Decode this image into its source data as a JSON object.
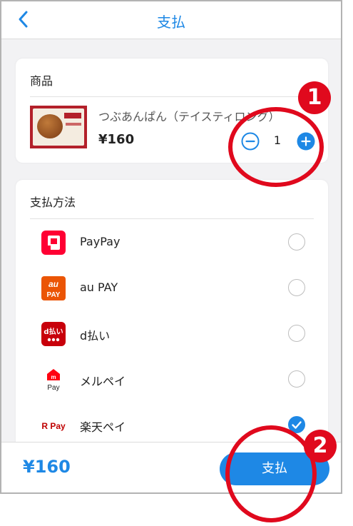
{
  "header": {
    "title": "支払"
  },
  "product_section": {
    "label": "商品",
    "item": {
      "name": "つぶあんぱん（テイスティロング）",
      "price": "¥160",
      "quantity": "1"
    }
  },
  "payment_section": {
    "label": "支払方法",
    "methods": [
      {
        "name": "PayPay",
        "icon": "paypay-icon",
        "selected": false
      },
      {
        "name": "au PAY",
        "icon": "aupay-icon",
        "icon_text_top": "au",
        "icon_text_bottom": "PAY",
        "selected": false
      },
      {
        "name": "d払い",
        "icon": "dbarai-icon",
        "icon_text": "d払い",
        "selected": false
      },
      {
        "name": "メルペイ",
        "icon": "merpay-icon",
        "icon_text": "Pay",
        "selected": false
      },
      {
        "name": "楽天ペイ",
        "icon": "rakutenpay-icon",
        "icon_text": "R Pay",
        "selected": true
      }
    ]
  },
  "footer": {
    "total": "¥160",
    "pay_button": "支払"
  },
  "annotations": [
    {
      "number": "1"
    },
    {
      "number": "2"
    }
  ],
  "colors": {
    "accent": "#1e88e5",
    "annotation": "#e0091d"
  }
}
